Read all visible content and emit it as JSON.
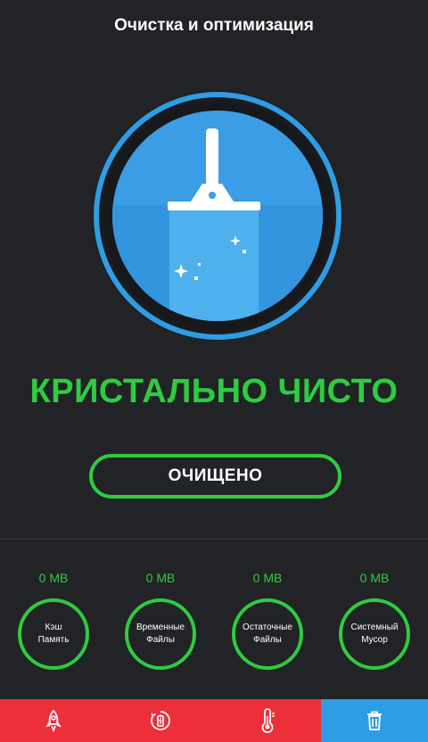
{
  "header": {
    "title": "Очистка и оптимизация"
  },
  "status": {
    "headline": "КРИСТАЛЬНО ЧИСТО",
    "button_label": "ОЧИЩЕНО"
  },
  "categories": [
    {
      "size": "0 MB",
      "label_line1": "Кэш",
      "label_line2": "Память"
    },
    {
      "size": "0 MB",
      "label_line1": "Временные",
      "label_line2": "Файлы"
    },
    {
      "size": "0 MB",
      "label_line1": "Остаточные",
      "label_line2": "Файлы"
    },
    {
      "size": "0 MB",
      "label_line1": "Системный",
      "label_line2": "Мусор"
    }
  ],
  "bottom_nav": {
    "items": [
      {
        "icon": "rocket-icon",
        "active": false
      },
      {
        "icon": "battery-icon",
        "active": false
      },
      {
        "icon": "thermometer-icon",
        "active": false
      },
      {
        "icon": "trash-icon",
        "active": true
      }
    ]
  },
  "colors": {
    "accent_green": "#2ecc40",
    "nav_red": "#ec2f3b",
    "nav_blue": "#2e9de3",
    "hero_blue": "#3399e0",
    "background": "#222326"
  }
}
